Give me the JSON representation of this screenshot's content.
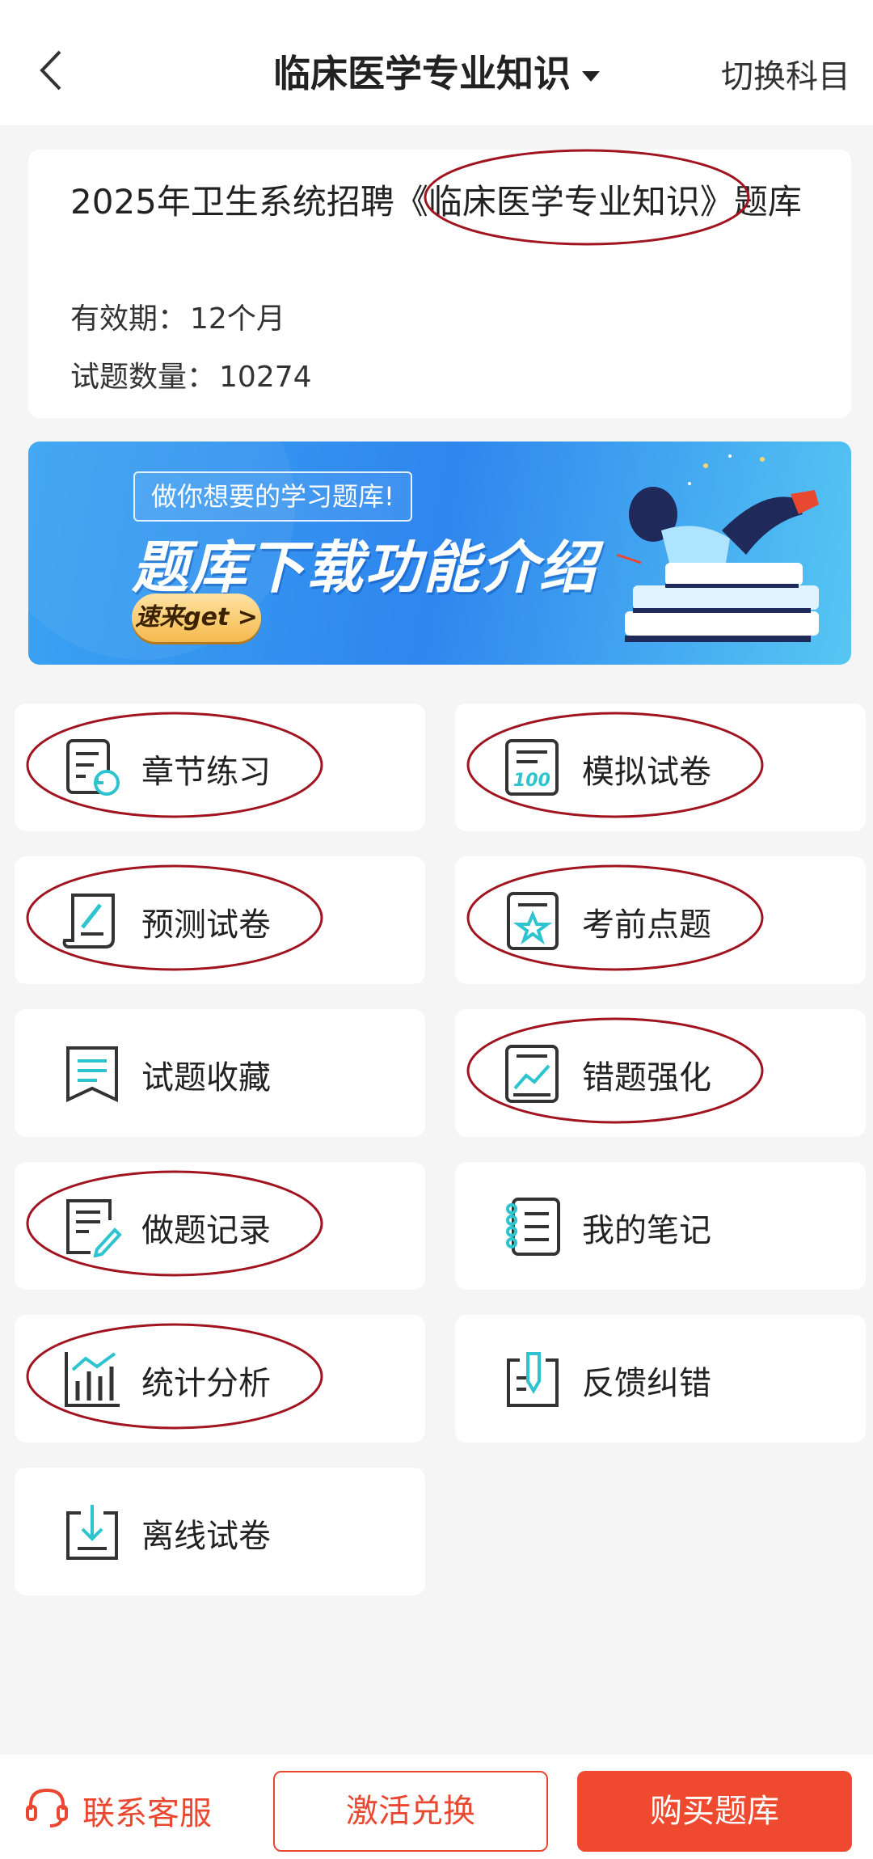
{
  "header": {
    "title": "临床医学专业知识",
    "switch_label": "切换科目"
  },
  "info": {
    "title": "2025年卫生系统招聘《临床医学专业知识》题库",
    "validity_label": "有效期：",
    "validity_value": "12个月",
    "count_label": "试题数量：",
    "count_value": "10274"
  },
  "banner": {
    "tag": "做你想要的学习题库!",
    "headline": "题库下载功能介绍",
    "cta": "速来get >"
  },
  "tiles": [
    {
      "label": "章节练习",
      "icon": "chapter-practice-icon"
    },
    {
      "label": "模拟试卷",
      "icon": "mock-exam-icon"
    },
    {
      "label": "预测试卷",
      "icon": "prediction-exam-icon"
    },
    {
      "label": "考前点题",
      "icon": "pre-exam-tips-icon"
    },
    {
      "label": "试题收藏",
      "icon": "bookmark-icon"
    },
    {
      "label": "错题强化",
      "icon": "wrong-questions-icon"
    },
    {
      "label": "做题记录",
      "icon": "practice-record-icon"
    },
    {
      "label": "我的笔记",
      "icon": "notebook-icon"
    },
    {
      "label": "统计分析",
      "icon": "statistics-icon"
    },
    {
      "label": "反馈纠错",
      "icon": "feedback-icon"
    },
    {
      "label": "离线试卷",
      "icon": "download-icon"
    }
  ],
  "bottom": {
    "service_label": "联系客服",
    "activate_label": "激活兑换",
    "buy_label": "购买题库"
  },
  "colors": {
    "accent": "#ef4a2f",
    "icon_teal": "#2ec4cf",
    "annotation_red": "#a01420"
  }
}
